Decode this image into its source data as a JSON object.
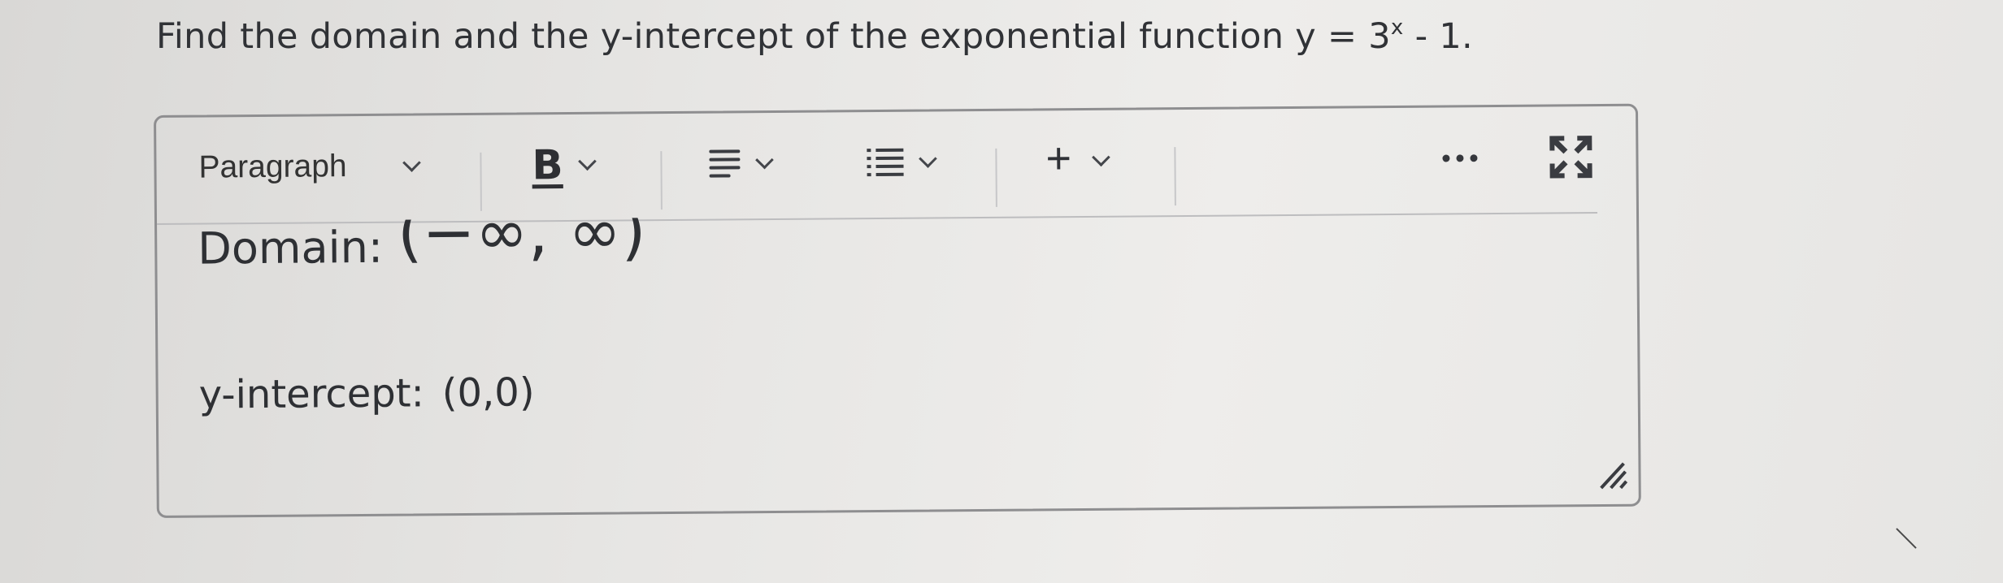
{
  "question": {
    "text": "Find the domain and the y-intercept of the exponential function y = 3",
    "exponent": "x",
    "suffix": " - 1."
  },
  "toolbar": {
    "format_select": {
      "value": "Paragraph",
      "icon": "chevron-down-icon"
    },
    "bold": {
      "label": "B",
      "icon": "chevron-down-icon"
    },
    "align": {
      "icon": "align-left-icon"
    },
    "list": {
      "icon": "bulleted-list-icon"
    },
    "insert": {
      "label": "+",
      "icon": "chevron-down-icon"
    },
    "more": {
      "icon": "more-horizontal-icon"
    },
    "fullscreen": {
      "icon": "fullscreen-icon"
    }
  },
  "editor": {
    "domain_label": "Domain:",
    "domain_value": "(−∞, ∞)",
    "intercept_label": "y-intercept:",
    "intercept_value": "(0,0)",
    "resize_icon": "resize-grip-icon"
  }
}
